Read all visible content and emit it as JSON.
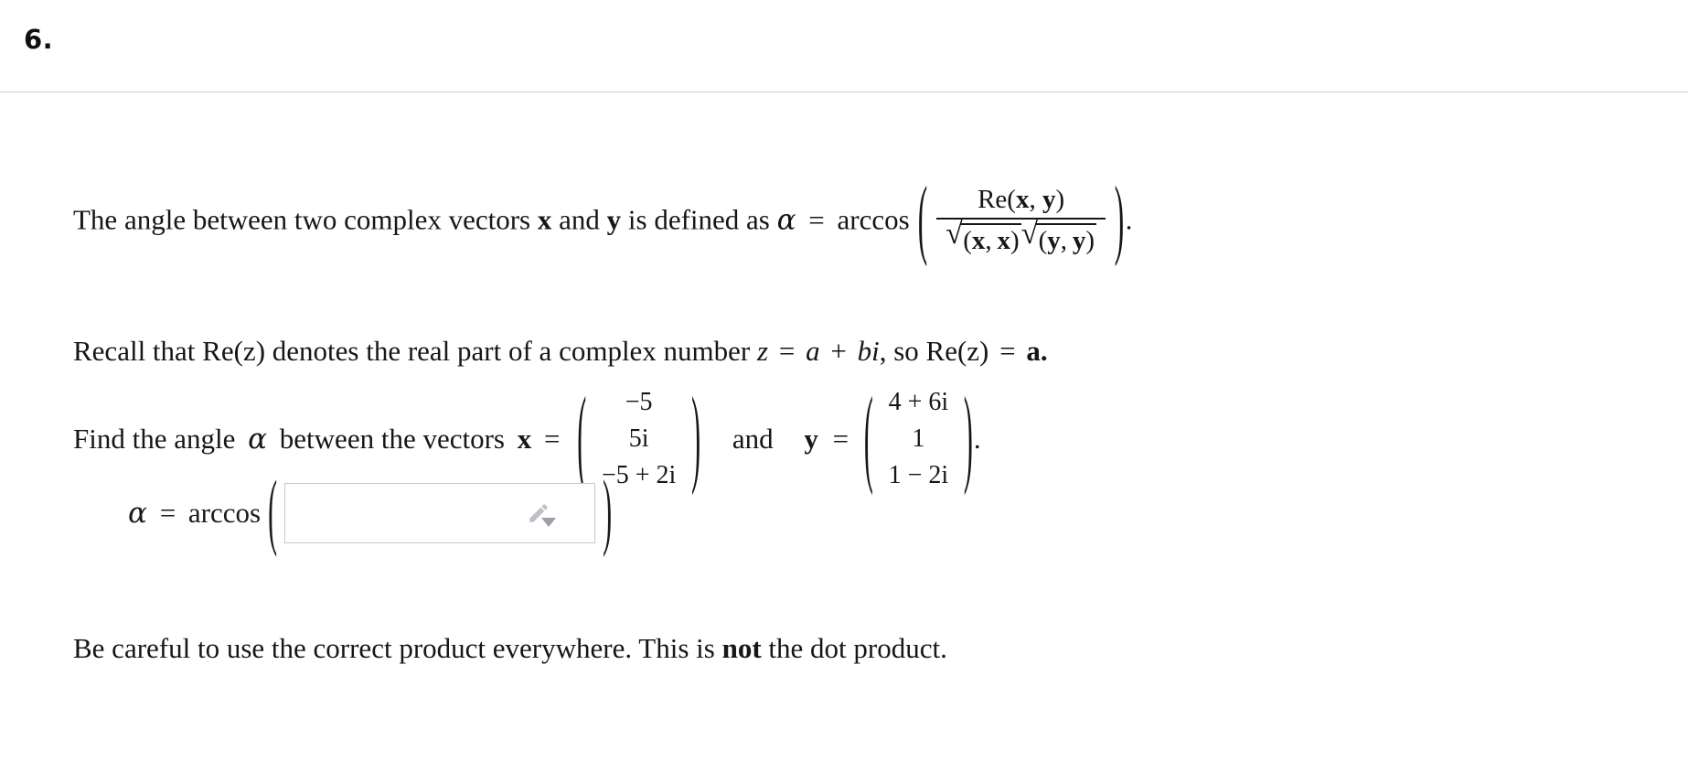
{
  "header": {
    "question_number": "6."
  },
  "problem": {
    "line1": {
      "text_before": "The angle between two complex vectors",
      "vector_x": "x",
      "text_and": "and",
      "vector_y": "y",
      "text_after": "is defined as",
      "alpha": "α",
      "equals": "=",
      "arccos": "arccos",
      "paren_open": "(",
      "numerator_re": "Re(",
      "numerator_x": "x",
      "numerator_comma": ", ",
      "numerator_y": "y",
      "numerator_close": ")",
      "denom_sqrt_sign": "√",
      "denom_first": "(x, x)",
      "denom_first_a": "x",
      "denom_first_b": "x",
      "denom_second_a": "y",
      "denom_second_b": "y",
      "paren_close": ")",
      "period": "."
    },
    "line2": {
      "text_start": "Recall that",
      "re_z": "Re(z)",
      "text_mid": "denotes the real part of a complex number",
      "z_var": "z",
      "equals": "=",
      "a_var": "a",
      "plus": "+",
      "bi_var": "bi",
      "comma_so": ", so",
      "re_z_2": "Re(z)",
      "equals2": "=",
      "result_a": "a."
    },
    "line3": {
      "text_start": "Find the angle",
      "alpha": "α",
      "text_mid": "between the vectors",
      "vector_x_label": "x",
      "equals": "=",
      "and_word": "and",
      "vector_y_label": "y",
      "equals2": "=",
      "period": "."
    },
    "vector_x": {
      "name": "x",
      "entries": [
        "−5",
        "5i",
        "−5 + 2i"
      ]
    },
    "vector_y": {
      "name": "y",
      "entries": [
        "4 + 6i",
        "1",
        "1 − 2i"
      ]
    },
    "answer": {
      "alpha": "α",
      "equals": "=",
      "arccos": "arccos",
      "paren_open": "(",
      "paren_close": ")",
      "input_value": "",
      "input_placeholder": "",
      "editor_icon": "pencil-icon",
      "caret_icon": "dropdown-caret-icon"
    },
    "line4": {
      "text_start": "Be careful to use the correct product everywhere. This is",
      "emphasis": "not",
      "text_end": "the dot product."
    }
  },
  "colors": {
    "text": "#15161a",
    "divider": "#c9cdd4",
    "input_border": "#c8c8c8",
    "icon_gray": "#bdc1c6",
    "caret_gray": "#9aa0a6"
  }
}
